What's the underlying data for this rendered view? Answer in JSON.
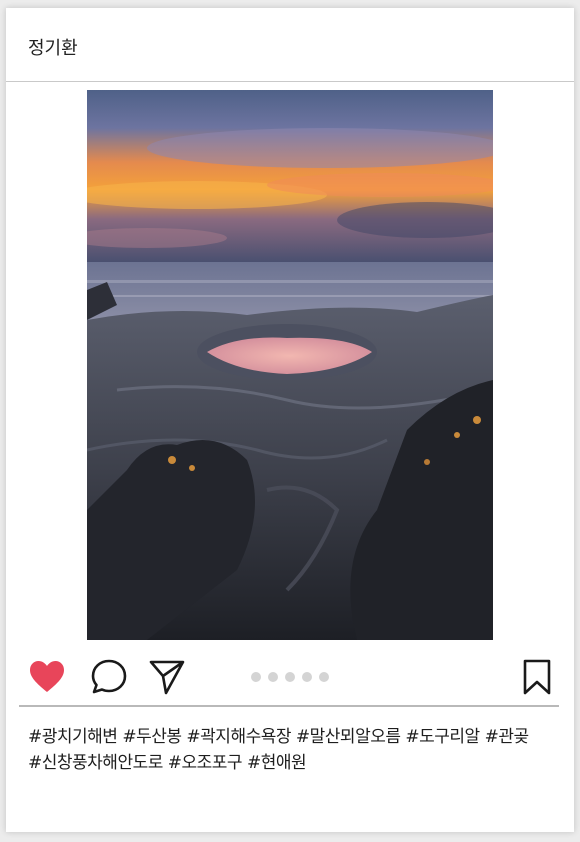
{
  "post": {
    "author": "정기환",
    "dots": 5,
    "hashtags_line1": "#광치기해변 #두산봉 #곽지해수욕장 #말산뫼알오름 #도구리알 #관곶",
    "hashtags_line2": "#신창풍차해안도로 #오조포구 #현애원"
  },
  "icons": {
    "like": "heart-icon",
    "comment": "speech-bubble-icon",
    "share": "paper-plane-icon",
    "save": "bookmark-icon"
  },
  "colors": {
    "like": "#e8455a",
    "icon_stroke": "#1a1a1a",
    "dot": "#d4d4d4"
  }
}
